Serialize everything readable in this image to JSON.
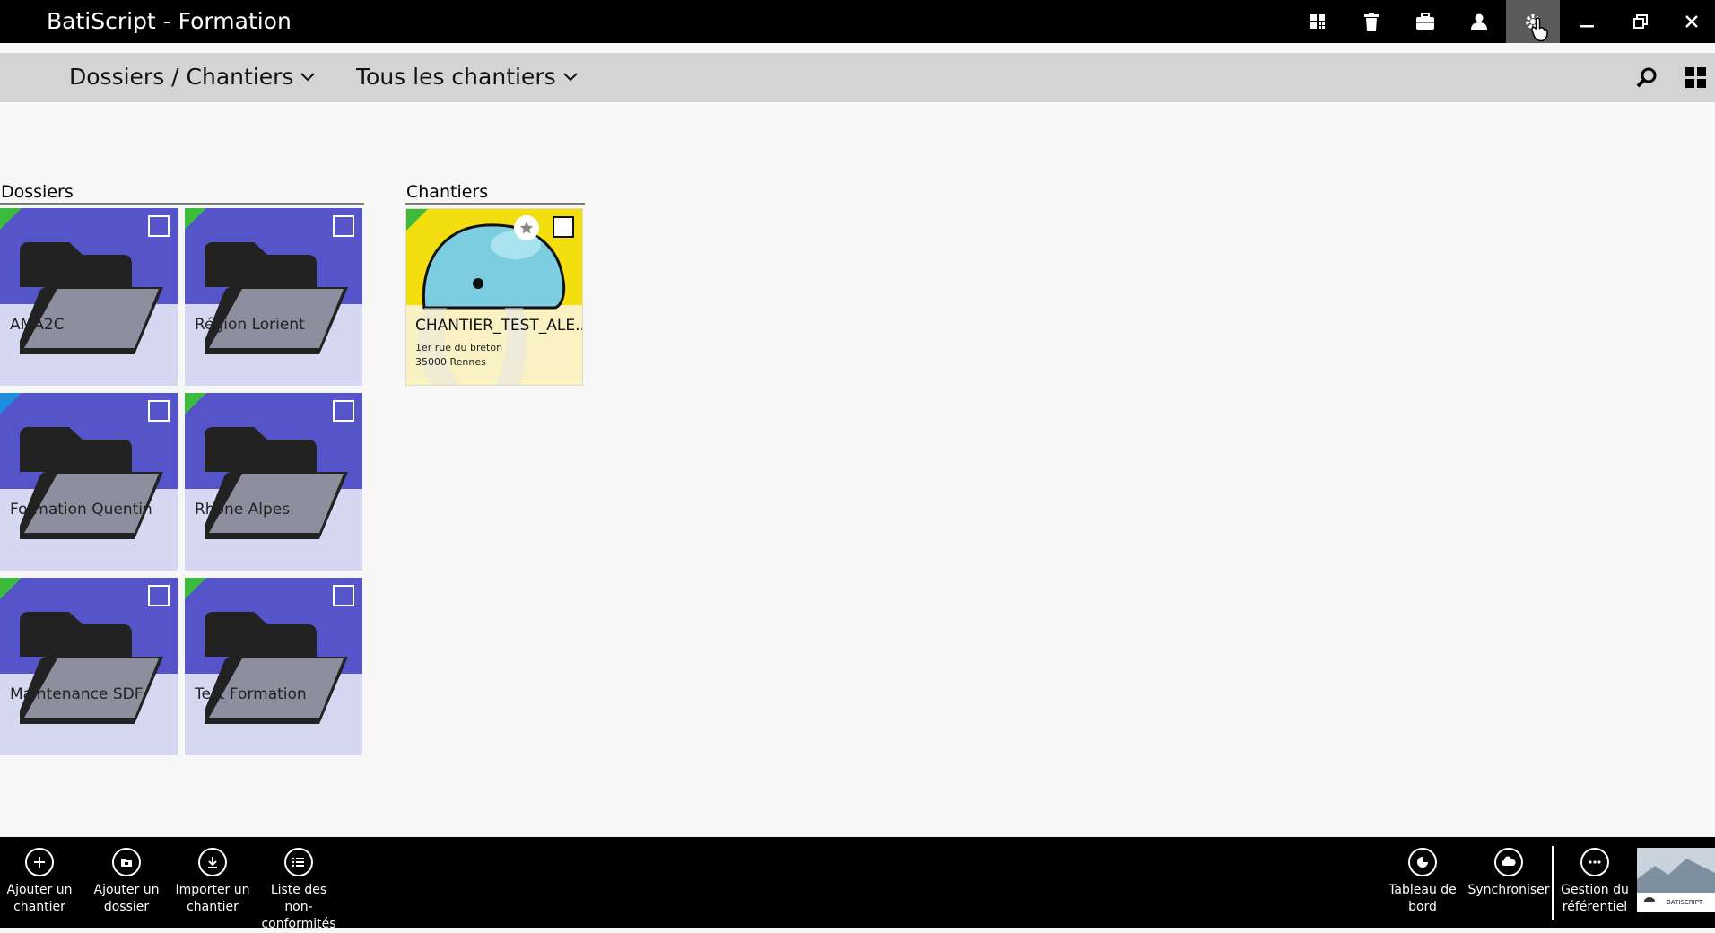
{
  "window": {
    "title": "BatiScript - Formation",
    "buttons": [
      "apps-icon",
      "trash-icon",
      "briefcase-icon",
      "user-icon",
      "settings-icon",
      "minimize-icon",
      "restore-icon",
      "close-icon"
    ]
  },
  "navbar": {
    "dossiers_dropdown": "Dossiers / Chantiers",
    "filter_dropdown": "Tous les chantiers"
  },
  "dossiers": {
    "heading": "Dossiers",
    "items": [
      {
        "label": "AMA2C",
        "corner_color": "#3dbb3d"
      },
      {
        "label": "Région Lorient",
        "corner_color": "#3dbb3d"
      },
      {
        "label": "Formation Quentin",
        "corner_color": "#1e8fe0"
      },
      {
        "label": "Rhone Alpes",
        "corner_color": "#3dbb3d"
      },
      {
        "label": "Maintenance SDF",
        "corner_color": "#3dbb3d"
      },
      {
        "label": "Test Formation",
        "corner_color": "#3dbb3d"
      }
    ]
  },
  "chantiers": {
    "heading": "Chantiers",
    "items": [
      {
        "name": "CHANTIER_TEST_ALE...",
        "address_line1": "1er rue du breton",
        "address_line2": "35000 Rennes",
        "corner_color": "#3dbb3d"
      }
    ]
  },
  "bottombar": {
    "left": [
      {
        "label_line1": "Ajouter un",
        "label_line2": "chantier",
        "icon": "plus-circle-icon"
      },
      {
        "label_line1": "Ajouter un",
        "label_line2": "dossier",
        "icon": "folder-circle-icon"
      },
      {
        "label_line1": "Importer un",
        "label_line2": "chantier",
        "icon": "download-circle-icon"
      },
      {
        "label_line1": "Liste des non-",
        "label_line2": "conformités",
        "icon": "list-circle-icon"
      }
    ],
    "right": [
      {
        "label_line1": "Tableau de",
        "label_line2": "bord",
        "icon": "dashboard-circle-icon"
      },
      {
        "label_line1": "Synchroniser",
        "label_line2": "",
        "icon": "cloud-circle-icon"
      },
      {
        "label_line1": "Gestion du",
        "label_line2": "référentiel",
        "icon": "more-circle-icon"
      }
    ],
    "logo_text": "BATISCRIPT"
  },
  "colors": {
    "folder_tile_top": "#5554c9",
    "folder_tile_bottom": "#d6d8f1",
    "navbar_bg": "#d5d4d5",
    "titlebar_bg": "#000000"
  }
}
